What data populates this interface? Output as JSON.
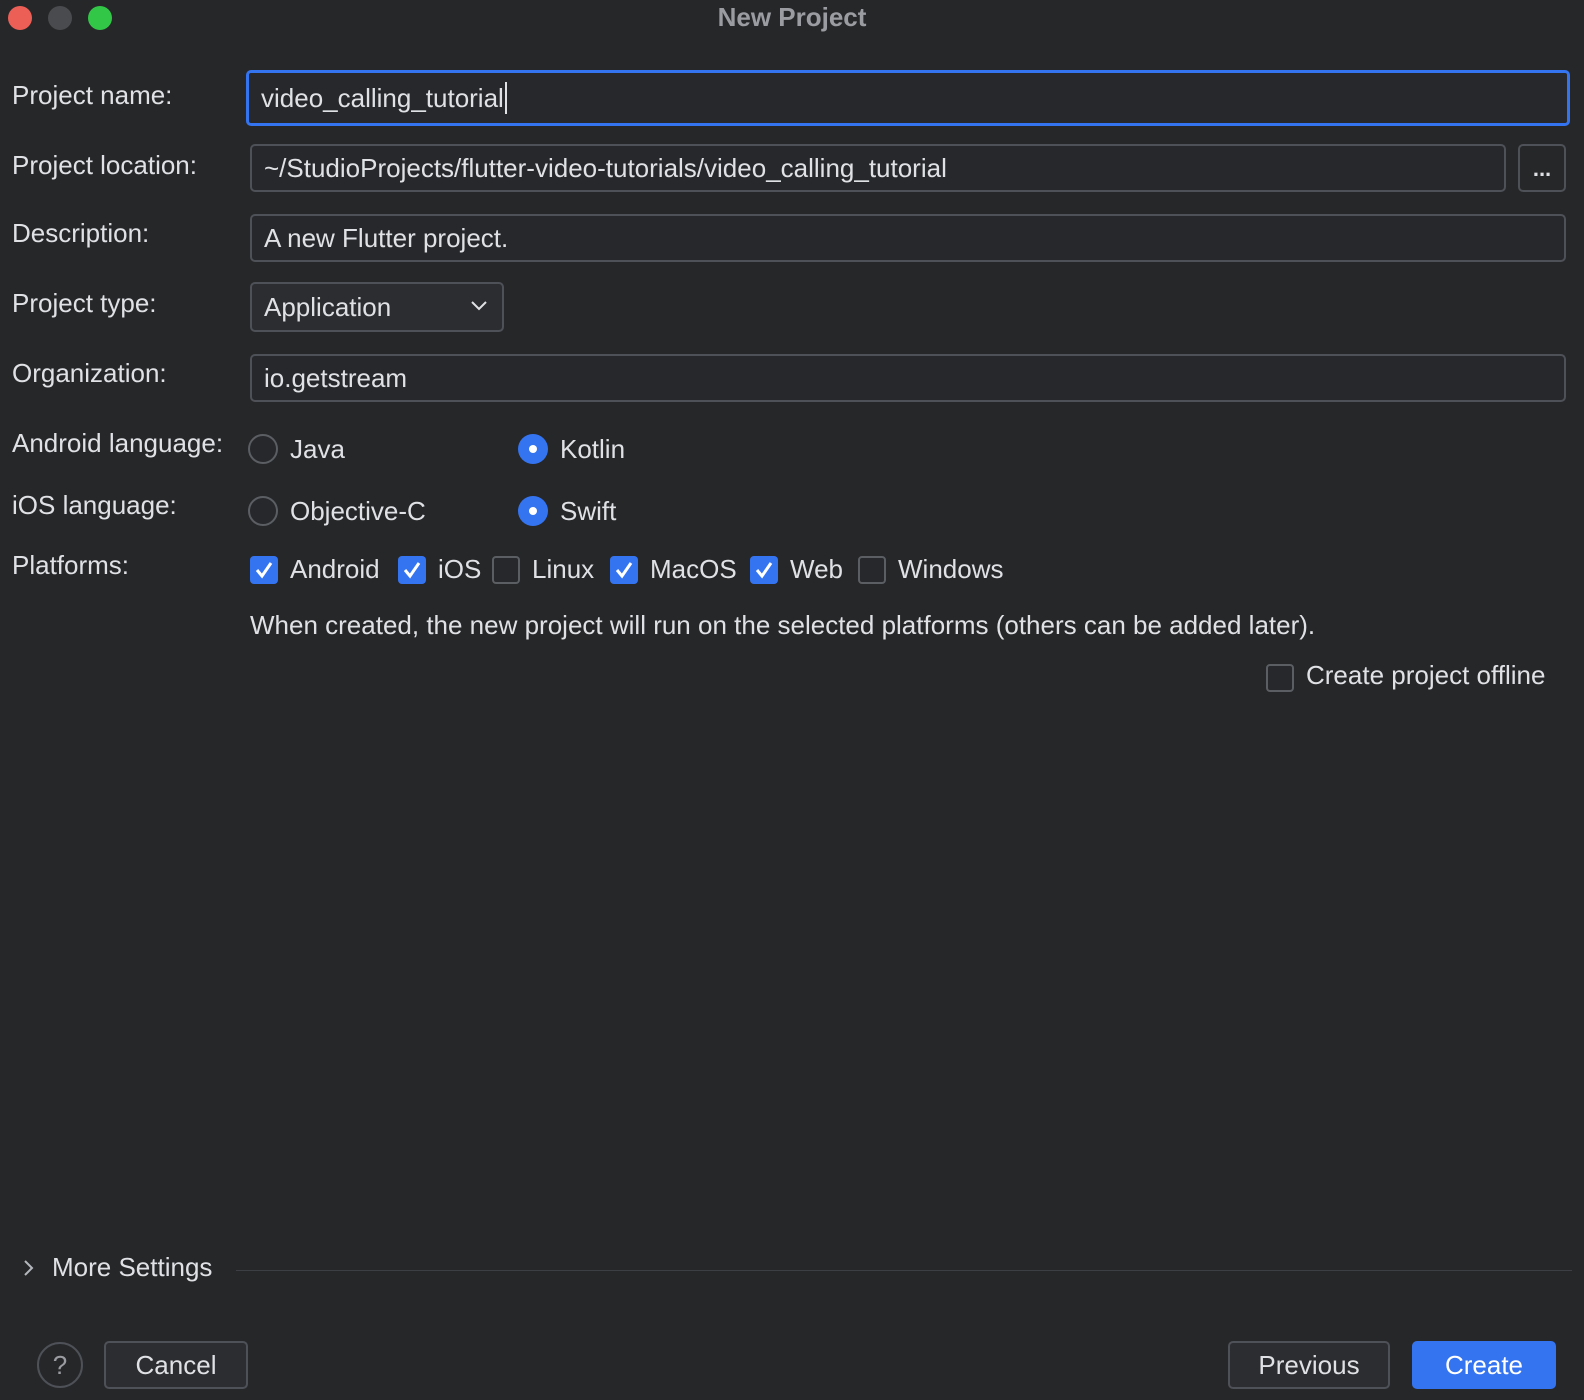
{
  "window": {
    "title": "New Project"
  },
  "form": {
    "project_name": {
      "label": "Project name:",
      "value": "video_calling_tutorial"
    },
    "project_location": {
      "label": "Project location:",
      "value": "~/StudioProjects/flutter-video-tutorials/video_calling_tutorial",
      "browse_label": "..."
    },
    "description": {
      "label": "Description:",
      "value": "A new Flutter project."
    },
    "project_type": {
      "label": "Project type:",
      "selected": "Application"
    },
    "organization": {
      "label": "Organization:",
      "value": "io.getstream"
    },
    "android_language": {
      "label": "Android language:",
      "options": [
        "Java",
        "Kotlin"
      ],
      "selected": "Kotlin"
    },
    "ios_language": {
      "label": "iOS language:",
      "options": [
        "Objective-C",
        "Swift"
      ],
      "selected": "Swift"
    },
    "platforms": {
      "label": "Platforms:",
      "items": [
        {
          "name": "Android",
          "checked": true
        },
        {
          "name": "iOS",
          "checked": true
        },
        {
          "name": "Linux",
          "checked": false
        },
        {
          "name": "MacOS",
          "checked": true
        },
        {
          "name": "Web",
          "checked": true
        },
        {
          "name": "Windows",
          "checked": false
        }
      ],
      "hint": "When created, the new project will run on the selected platforms (others can be added later)."
    },
    "create_offline": {
      "label": "Create project offline",
      "checked": false
    }
  },
  "more_settings": {
    "label": "More Settings"
  },
  "footer": {
    "help_label": "?",
    "cancel_label": "Cancel",
    "previous_label": "Previous",
    "create_label": "Create"
  },
  "colors": {
    "background": "#262729",
    "accent": "#3574f0",
    "text": "#dfe1e5",
    "border": "#4e5157"
  }
}
